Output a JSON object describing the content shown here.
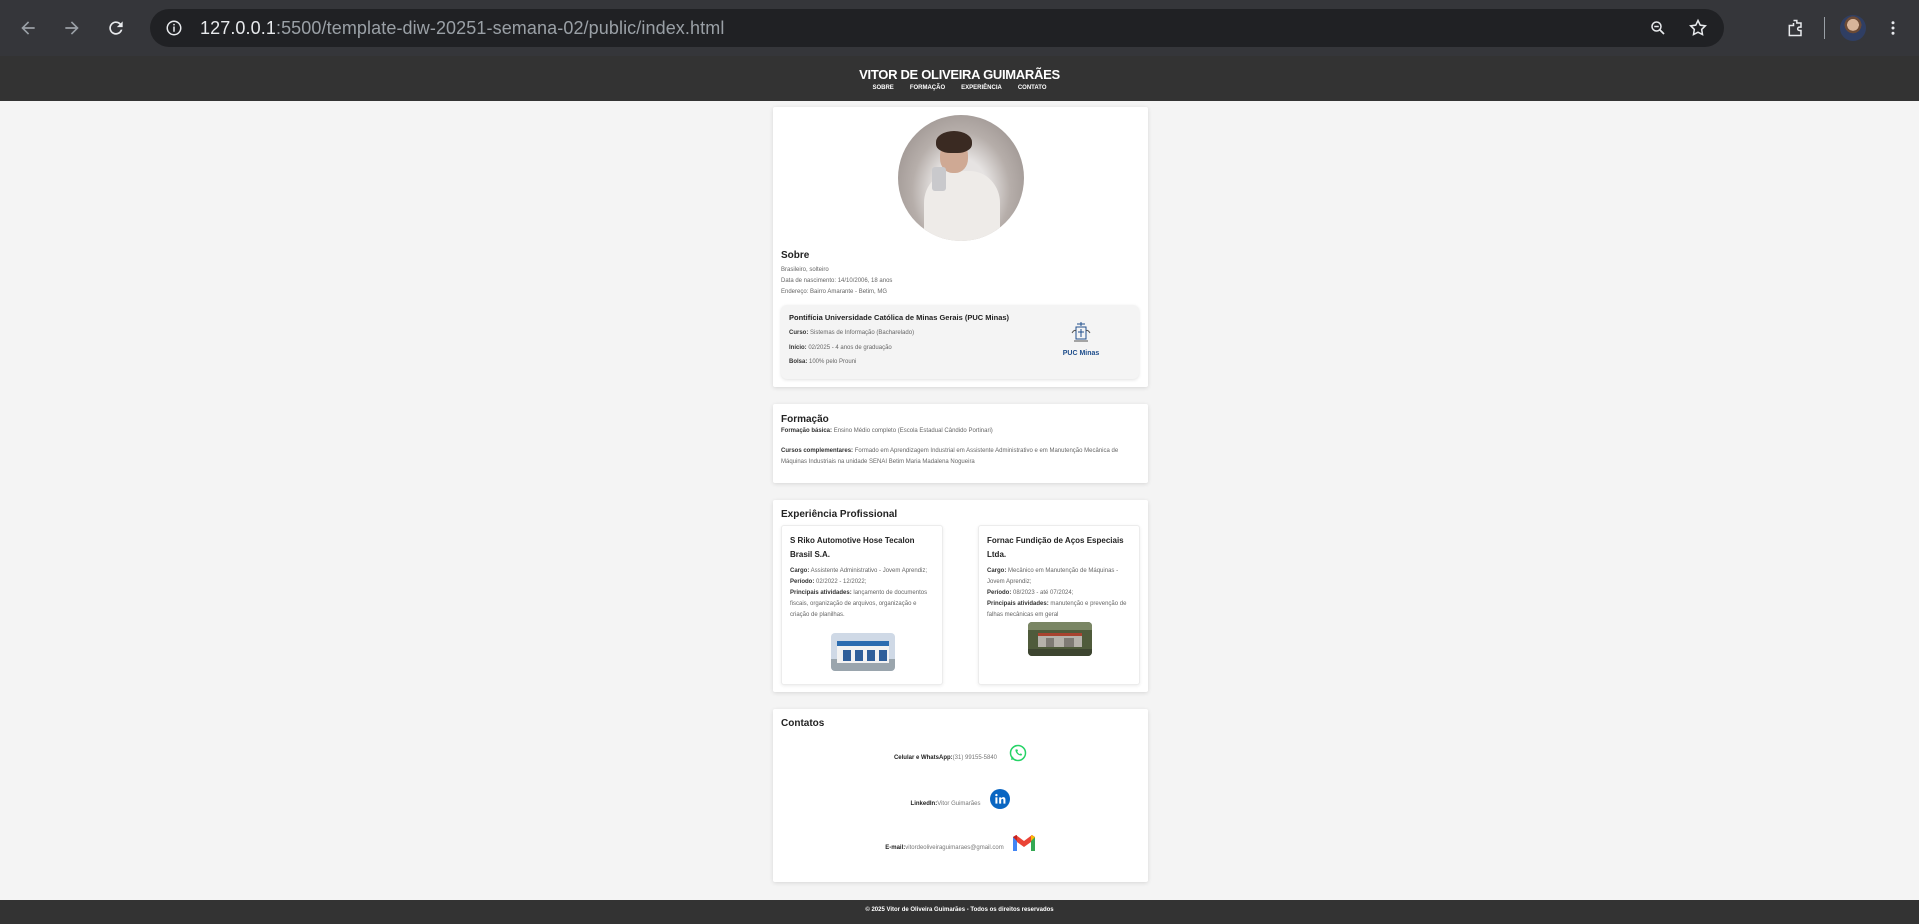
{
  "browser": {
    "url_host": "127.0.0.1",
    "url_rest": ":5500/template-diw-20251-semana-02/public/index.html"
  },
  "header": {
    "title": "VITOR DE OLIVEIRA GUIMARÃES",
    "nav": [
      "SOBRE",
      "FORMAÇÃO",
      "EXPERIÊNCIA",
      "CONTATO"
    ]
  },
  "sobre": {
    "heading": "Sobre",
    "lines": [
      "Brasileiro, solteiro",
      "Data de nascimento: 14/10/2006, 18 anos",
      "Endereço: Bairro Amarante - Betim, MG"
    ],
    "edu": {
      "title": "Pontifícia Universidade Católica de Minas Gerais (PUC Minas)",
      "rows": [
        {
          "label": "Curso:",
          "value": " Sistemas de Informação (Bacharelado)"
        },
        {
          "label": "Início:",
          "value": " 02/2025 - 4 anos de graduação"
        },
        {
          "label": "Bolsa:",
          "value": " 100% pelo Prouni"
        }
      ],
      "logo_text": "PUC Minas"
    }
  },
  "formacao": {
    "heading": "Formação",
    "basica_label": "Formação básica:",
    "basica_value": " Ensino Médio completo (Escola Estadual Cândido Portinari)",
    "cursos_label": "Cursos complementares:",
    "cursos_value": " Formado em Aprendizagem Industrial em Assistente Administrativo e em Manutenção Mecânica de Máquinas Industriais na unidade SENAI Betim Maria Madalena Nogueira"
  },
  "experiencia": {
    "heading": "Experiência Profissional",
    "jobs": [
      {
        "company": "S Riko Automotive Hose Tecalon Brasil S.A.",
        "cargo_label": "Cargo:",
        "cargo": " Assistente Administrativo - Jovem Aprendiz;",
        "periodo_label": "Período:",
        "periodo": " 02/2022 - 12/2022;",
        "ativ_label": "Principais atividades:",
        "ativ": " lançamento de documentos fiscais, organização de arquivos, organização e criação de planilhas."
      },
      {
        "company": "Fornac Fundição de Aços Especiais Ltda.",
        "cargo_label": "Cargo:",
        "cargo": " Mecânico em Manutenção de Máquinas - Jovem Aprendiz;",
        "periodo_label": "Período:",
        "periodo": " 08/2023 - até 07/2024;",
        "ativ_label": "Principais atividades:",
        "ativ": " manutenção e prevenção de falhas mecânicas em geral"
      }
    ]
  },
  "contatos": {
    "heading": "Contatos",
    "items": [
      {
        "label": "Celular e WhatsApp:",
        "value": "(31) 99155-5840",
        "icon": "whatsapp-icon"
      },
      {
        "label": "LinkedIn:",
        "value": "Vitor Guimarães",
        "icon": "linkedin-icon"
      },
      {
        "label": "E-mail:",
        "value": "vitordeoliveiraguimaraes@gmail.com",
        "icon": "gmail-icon"
      }
    ]
  },
  "footer": {
    "text": "© 2025 Vitor de Oliveira Guimarães - Todos os direitos reservados"
  },
  "colors": {
    "header_bg": "#333333",
    "page_bg": "#f4f4f4",
    "whatsapp": "#25d366",
    "linkedin": "#0a66c2",
    "puc_blue": "#1f4e8c"
  }
}
